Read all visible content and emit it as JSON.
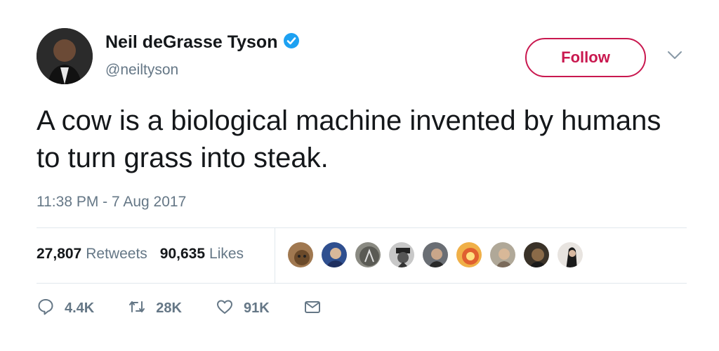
{
  "author": {
    "name": "Neil deGrasse Tyson",
    "handle": "@neiltyson",
    "verified": true
  },
  "follow_label": "Follow",
  "tweet_text": "A cow is a biological machine invented by humans to turn grass into steak.",
  "timestamp": "11:38 PM - 7 Aug 2017",
  "stats": {
    "retweets_count": "27,807",
    "retweets_label": "Retweets",
    "likes_count": "90,635",
    "likes_label": "Likes"
  },
  "liker_avatars": [
    "avatar",
    "avatar",
    "avatar",
    "avatar",
    "avatar",
    "avatar",
    "avatar",
    "avatar",
    "avatar"
  ],
  "actions": {
    "reply_count": "4.4K",
    "retweet_count": "28K",
    "like_count": "91K"
  },
  "colors": {
    "follow_accent": "#c9184f",
    "verified_blue": "#1da1f2",
    "muted_text": "#657786"
  },
  "icons": {
    "verified": "verified-badge-icon",
    "chevron": "chevron-down-icon",
    "reply": "reply-icon",
    "retweet": "retweet-icon",
    "like": "heart-icon",
    "message": "message-icon"
  }
}
